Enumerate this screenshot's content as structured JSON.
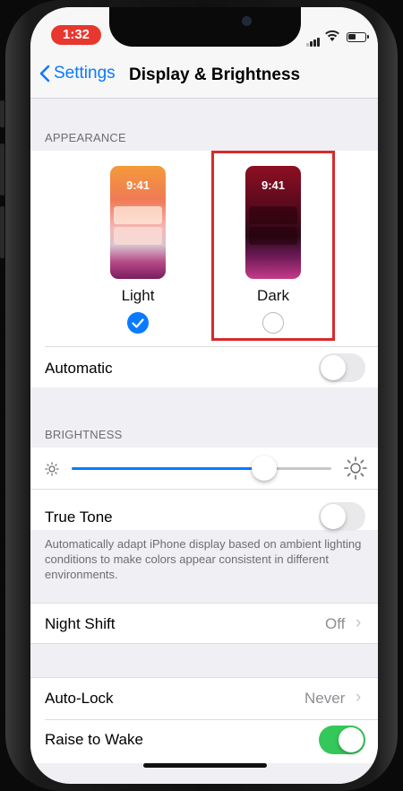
{
  "status_bar": {
    "time": "1:32"
  },
  "nav": {
    "back_label": "Settings",
    "title": "Display & Brightness"
  },
  "appearance": {
    "header": "APPEARANCE",
    "options": [
      {
        "label": "Light",
        "preview_time": "9:41",
        "selected": true
      },
      {
        "label": "Dark",
        "preview_time": "9:41",
        "selected": false
      }
    ],
    "automatic": {
      "label": "Automatic",
      "enabled": false
    }
  },
  "brightness": {
    "header": "BRIGHTNESS",
    "level_percent": 74,
    "true_tone": {
      "label": "True Tone",
      "enabled": false
    },
    "footer": "Automatically adapt iPhone display based on ambient lighting conditions to make colors appear consistent in different environments."
  },
  "night_shift": {
    "label": "Night Shift",
    "value": "Off"
  },
  "auto_lock": {
    "label": "Auto-Lock",
    "value": "Never"
  },
  "raise_to_wake": {
    "label": "Raise to Wake",
    "enabled": true
  },
  "colors": {
    "accent": "#0a7aff",
    "switch_on": "#34c759",
    "highlight": "#d52b2b",
    "status_time": "#e8372f"
  },
  "icons": [
    "chevron-left-icon",
    "signal-icon",
    "wifi-icon",
    "battery-icon",
    "checkmark-icon",
    "sun-small-icon",
    "sun-large-icon",
    "chevron-right-icon"
  ]
}
